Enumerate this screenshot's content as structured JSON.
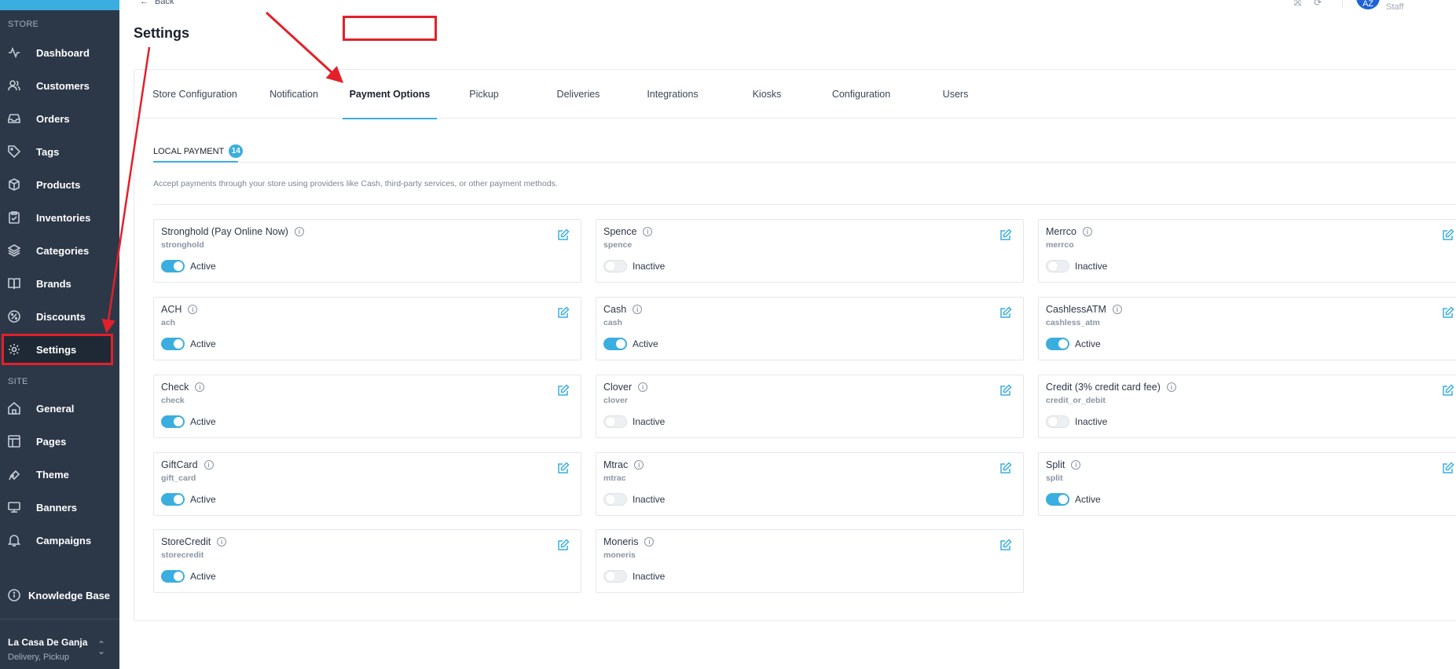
{
  "sidebar": {
    "store_section": "STORE",
    "site_section": "SITE",
    "store_items": [
      {
        "label": "Dashboard",
        "icon": "activity-icon"
      },
      {
        "label": "Customers",
        "icon": "users-icon"
      },
      {
        "label": "Orders",
        "icon": "inbox-icon"
      },
      {
        "label": "Tags",
        "icon": "tag-icon"
      },
      {
        "label": "Products",
        "icon": "box-icon"
      },
      {
        "label": "Inventories",
        "icon": "clipboard-icon"
      },
      {
        "label": "Categories",
        "icon": "layers-icon"
      },
      {
        "label": "Brands",
        "icon": "book-icon"
      },
      {
        "label": "Discounts",
        "icon": "percent-icon"
      },
      {
        "label": "Settings",
        "icon": "gear-icon"
      }
    ],
    "site_items": [
      {
        "label": "General",
        "icon": "home-icon"
      },
      {
        "label": "Pages",
        "icon": "layout-icon"
      },
      {
        "label": "Theme",
        "icon": "pen-tool-icon"
      },
      {
        "label": "Banners",
        "icon": "monitor-icon"
      },
      {
        "label": "Campaigns",
        "icon": "bell-icon"
      }
    ],
    "knowledge_base": "Knowledge Base",
    "store_name": "La Casa De Ganja",
    "store_sub": "Delivery, Pickup"
  },
  "header": {
    "back_label": "Back",
    "title": "Settings",
    "avatar_initials": "AZ",
    "role": "Staff"
  },
  "tabs": [
    {
      "label": "Store Configuration"
    },
    {
      "label": "Notification"
    },
    {
      "label": "Payment Options"
    },
    {
      "label": "Pickup"
    },
    {
      "label": "Deliveries"
    },
    {
      "label": "Integrations"
    },
    {
      "label": "Kiosks"
    },
    {
      "label": "Configuration"
    },
    {
      "label": "Users"
    }
  ],
  "active_tab": "Payment Options",
  "subtab": {
    "label": "LOCAL PAYMENT",
    "count": "14"
  },
  "description": "Accept payments through your store using providers like Cash, third-party services, or other payment methods.",
  "payments": [
    {
      "name": "Stronghold (Pay Online Now)",
      "slug": "stronghold",
      "status": "Active"
    },
    {
      "name": "Spence",
      "slug": "spence",
      "status": "Inactive"
    },
    {
      "name": "Merrco",
      "slug": "merrco",
      "status": "Inactive"
    },
    {
      "name": "ACH",
      "slug": "ach",
      "status": "Active"
    },
    {
      "name": "Cash",
      "slug": "cash",
      "status": "Active"
    },
    {
      "name": "CashlessATM",
      "slug": "cashless_atm",
      "status": "Active"
    },
    {
      "name": "Check",
      "slug": "check",
      "status": "Active"
    },
    {
      "name": "Clover",
      "slug": "clover",
      "status": "Inactive"
    },
    {
      "name": "Credit (3% credit card fee)",
      "slug": "credit_or_debit",
      "status": "Inactive"
    },
    {
      "name": "GiftCard",
      "slug": "gift_card",
      "status": "Active"
    },
    {
      "name": "Mtrac",
      "slug": "mtrac",
      "status": "Inactive"
    },
    {
      "name": "Split",
      "slug": "split",
      "status": "Active"
    },
    {
      "name": "StoreCredit",
      "slug": "storecredit",
      "status": "Active"
    },
    {
      "name": "Moneris",
      "slug": "moneris",
      "status": "Inactive"
    }
  ],
  "colors": {
    "sidebar_bg": "#2c3848",
    "accent": "#3aaedf",
    "annotation_red": "#e3202a"
  }
}
